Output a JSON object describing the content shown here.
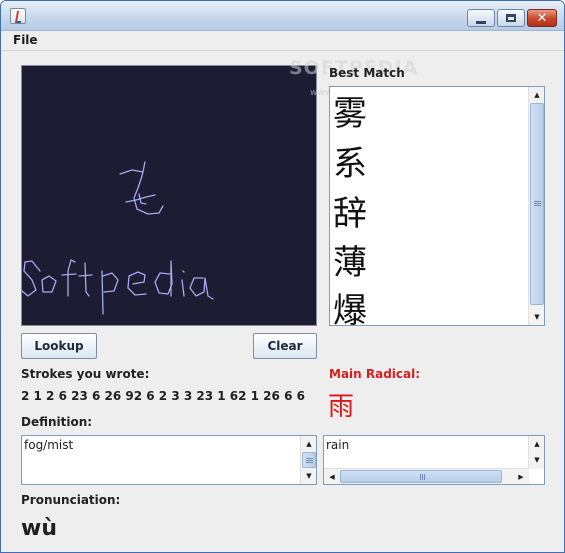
{
  "menu": {
    "file": "File"
  },
  "best_match": {
    "label": "Best Match",
    "items": [
      "雾",
      "系",
      "辞",
      "薄",
      "爆"
    ]
  },
  "buttons": {
    "lookup": "Lookup",
    "clear": "Clear"
  },
  "strokes": {
    "label": "Strokes you wrote:",
    "value": "2 1 2 6 23 6 26 92 6 2 3 3 23 1 62 1 26 6 6"
  },
  "definition": {
    "label": "Definition:",
    "value": "fog/mist"
  },
  "radical": {
    "label": "Main Radical:",
    "char": "雨",
    "meaning": "rain"
  },
  "pronunciation": {
    "label": "Pronunciation:",
    "value": "wù"
  },
  "watermark": {
    "text": "SOFTPEDIA",
    "url": "www.softpedia.com"
  },
  "colors": {
    "canvas_bg": "#1e1c33",
    "ink": "#a9a8f0",
    "radical_red": "#e01515"
  }
}
